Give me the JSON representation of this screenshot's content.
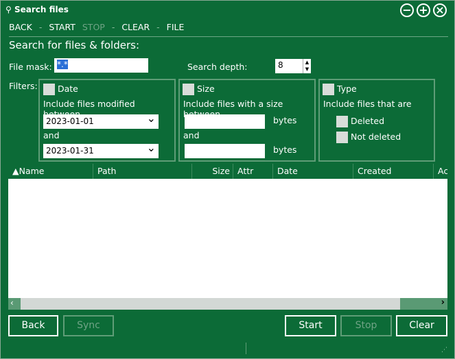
{
  "window": {
    "title": "Search files",
    "controls": [
      "minimize",
      "maximize",
      "close"
    ]
  },
  "menu": {
    "back": "BACK",
    "start": "START",
    "stop": "STOP",
    "clear": "CLEAR",
    "file": "FILE",
    "sep": "-"
  },
  "heading": "Search for files & folders:",
  "file_mask": {
    "label": "File mask:",
    "value": "*.*"
  },
  "search_depth": {
    "label": "Search depth:",
    "value": "8"
  },
  "filters": {
    "label": "Filters:",
    "date": {
      "label": "Date",
      "desc": "Include files modified between",
      "from": "2023-01-01",
      "and": "and",
      "to": "2023-01-31"
    },
    "size": {
      "label": "Size",
      "desc": "Include files with a size between",
      "unit1": "bytes",
      "and": "and",
      "unit2": "bytes"
    },
    "type": {
      "label": "Type",
      "desc": "Include files that are",
      "deleted": "Deleted",
      "not_deleted": "Not deleted"
    }
  },
  "table": {
    "columns": [
      "▲Name",
      "Path",
      "Size",
      "Attr",
      "Date",
      "Created",
      "Ac"
    ]
  },
  "buttons": {
    "back": "Back",
    "sync": "Sync",
    "start": "Start",
    "stop": "Stop",
    "clear": "Clear"
  }
}
